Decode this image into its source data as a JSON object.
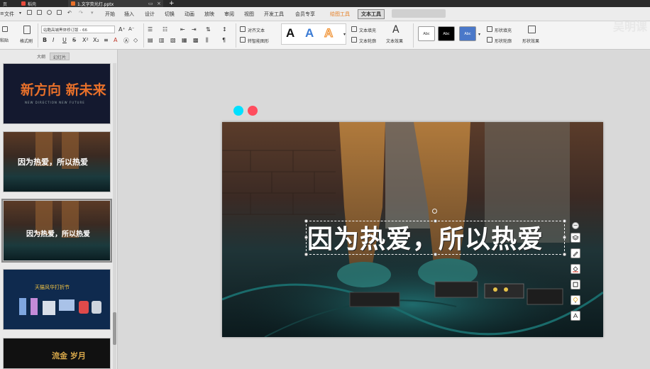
{
  "titlebar": {
    "tabs": [
      {
        "label": "页",
        "icon": "home-icon"
      },
      {
        "label": "稻壳",
        "icon": "docer-icon"
      },
      {
        "label": "1.文字荧光灯.pptx",
        "icon": "ppt-file-icon"
      }
    ],
    "new_tab_label": "+"
  },
  "menubar": {
    "file_label": "文件",
    "items": [
      "开始",
      "插入",
      "设计",
      "切换",
      "动画",
      "放映",
      "审阅",
      "视图",
      "开发工具",
      "会员专享"
    ],
    "context_tabs": [
      "绘图工具",
      "文本工具"
    ]
  },
  "ribbon": {
    "format_painter": "格式刷",
    "font_name": "站酷高端黑体修订版 - 66",
    "text_dir": "对齐文本",
    "smartart": "转智能图形",
    "text_fill": "文本填充",
    "text_outline": "文本轮廓",
    "text_effect": "文本效果",
    "shape_fill": "形状填充",
    "shape_outline": "形状轮廓",
    "shape_effect": "形状效果",
    "wordart_letters": [
      "A",
      "A",
      "A"
    ],
    "style_swatches": [
      "Abc",
      "Abc",
      "Abc"
    ],
    "left_label": "粘贴"
  },
  "watermark": "吴明课",
  "panel": {
    "tabs": [
      "大纲",
      "幻灯片"
    ]
  },
  "thumbnails": [
    {
      "title": "新方向 新未来",
      "subtitle": "NEW DIRECTION  NEW FUTURE"
    },
    {
      "title": "因为热爱，所以热爱"
    },
    {
      "title": "因为热爱，所以热爱"
    },
    {
      "title": "天猫风华打折节"
    },
    {
      "title": "流金 岁月"
    }
  ],
  "slide": {
    "title": "因为热爱，所以热爱"
  },
  "colors": {
    "accent_cyan": "#00e0ff",
    "accent_red": "#ff4d5e",
    "wordart_blue": "#3a7bd5",
    "wordart_orange": "#f08a24",
    "thumb_orange": "#e8702a"
  }
}
